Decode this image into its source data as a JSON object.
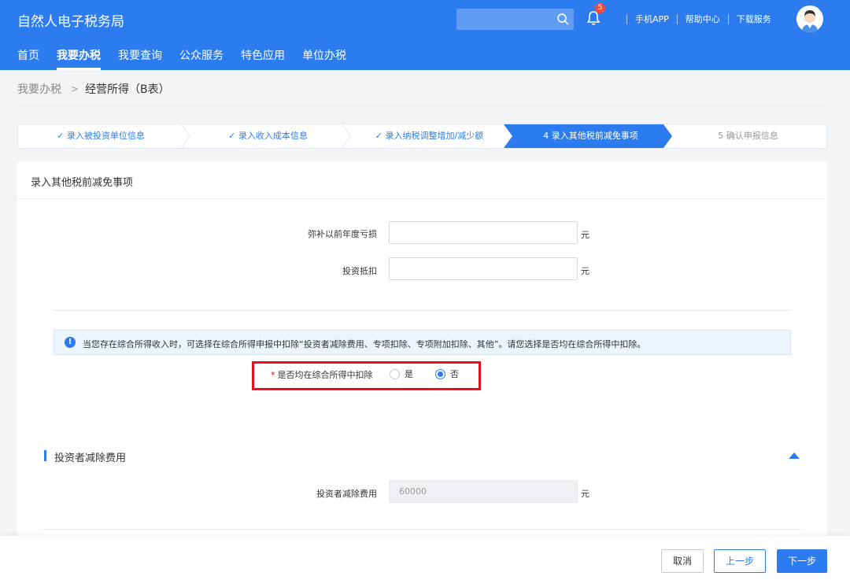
{
  "header": {
    "app_title": "自然人电子税务局",
    "search_placeholder": "",
    "notification_count": "5",
    "links": [
      "手机APP",
      "帮助中心",
      "下载服务"
    ]
  },
  "nav": {
    "items": [
      "首页",
      "我要办税",
      "我要查询",
      "公众服务",
      "特色应用",
      "单位办税"
    ],
    "active": "我要办税"
  },
  "breadcrumb": {
    "root": "我要办税",
    "separator": ">",
    "current": "经营所得（B表）"
  },
  "steps": [
    {
      "label": "✓ 录入被投资单位信息",
      "state": "done"
    },
    {
      "label": "✓ 录入收入成本信息",
      "state": "done"
    },
    {
      "label": "✓ 录入纳税调整增加/减少额",
      "state": "done"
    },
    {
      "label": "4  录入其他税前减免事项",
      "state": "active"
    },
    {
      "label": "5  确认申报信息",
      "state": "todo"
    }
  ],
  "panel": {
    "title": "录入其他税前减免事项",
    "fields": [
      {
        "label": "弥补以前年度亏损",
        "value": "",
        "unit": "元"
      },
      {
        "label": "投资抵扣",
        "value": "",
        "unit": "元"
      }
    ],
    "notice": "当您存在综合所得收入时，可选择在综合所得申报中扣除“投资者减除费用、专项扣除、专项附加扣除、其他”。请您选择是否均在综合所得中扣除。",
    "question": {
      "required_mark": "*",
      "label": "是否均在综合所得中扣除",
      "options": [
        "是",
        "否"
      ],
      "selected": "否"
    },
    "section": {
      "title": "投资者减除费用",
      "field_label": "投资者减除费用",
      "field_value": "60000",
      "unit": "元"
    }
  },
  "footer": {
    "cancel": "取消",
    "prev": "上一步",
    "next": "下一步"
  },
  "colors": {
    "primary": "#2c7cf0",
    "highlight": "#e8101a"
  }
}
